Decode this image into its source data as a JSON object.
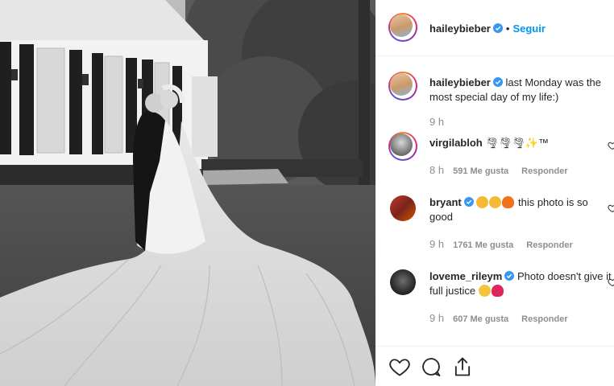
{
  "post_author": {
    "username": "haileybieber",
    "separator": "•",
    "follow_label": "Seguir"
  },
  "caption": {
    "username": "haileybieber",
    "text": "last Monday was the most special day of my life:)",
    "time": "9 h"
  },
  "comments": [
    {
      "username": "virgilabloh",
      "text": "🌪🌪🌪✨™",
      "time": "8 h",
      "likes": "591 Me gusta",
      "reply": "Responder"
    },
    {
      "username": "bryant",
      "text": "this photo is so good",
      "time": "9 h",
      "likes": "1761 Me gusta",
      "reply": "Responder"
    },
    {
      "username": "loveme_rileym",
      "text": "Photo doesn't give it full justice",
      "time": "9 h",
      "likes": "607 Me gusta",
      "reply": "Responder"
    }
  ],
  "colors": {
    "link_blue": "#0095f6",
    "verified_blue": "#3897f0",
    "secondary_text": "#8e8e8e",
    "border": "#efefef"
  },
  "icons": [
    "verified-badge-icon",
    "heart-icon",
    "comment-icon",
    "share-icon"
  ]
}
